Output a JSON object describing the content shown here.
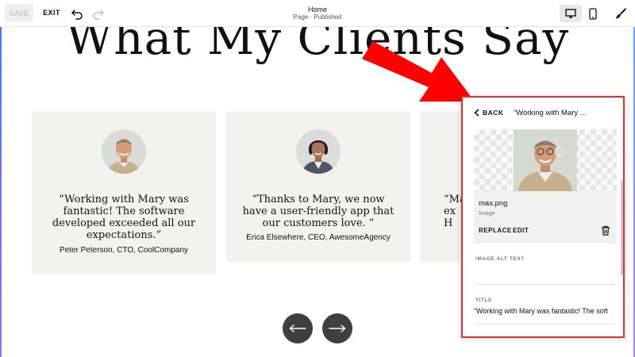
{
  "toolbar": {
    "save_label": "SAVE",
    "exit_label": "EXIT",
    "page_title": "Home",
    "page_status": "Page · Published",
    "undo_icon": "undo-icon",
    "redo_icon": "redo-icon",
    "desktop_icon": "desktop-icon",
    "mobile_icon": "mobile-icon",
    "style_icon": "paintbrush-icon"
  },
  "section": {
    "heading": "What My Clients Say"
  },
  "testimonials": [
    {
      "quote": "“Working with Mary was fantastic! The software developed exceeded all our expectations.”",
      "attribution": "Peter Peterson, CTO, CoolCompany"
    },
    {
      "quote": "“Thanks to Mary, we now have a user-friendly app that our customers love. ”",
      "attribution": "Erica Elsewhere, CEO, AwesomeAgency"
    },
    {
      "quote_fragment": "“Ma\nex\nH\n"
    }
  ],
  "carousel": {
    "prev_icon": "arrow-left-icon",
    "next_icon": "arrow-right-icon"
  },
  "panel": {
    "back_label": "BACK",
    "heading": "“Working with Mary ...",
    "file_name": "max.png",
    "file_type": "Image",
    "replace_label": "REPLACE",
    "edit_label": "EDIT",
    "alt_text_label": "IMAGE ALT TEXT",
    "alt_text_value": "",
    "title_label": "TITLE",
    "title_value": "“Working with Mary was fantastic! The soft"
  },
  "colors": {
    "annotation_red": "#e03030",
    "card_bg": "#f2f2f0",
    "arrow_button": "#3f3f3f"
  }
}
